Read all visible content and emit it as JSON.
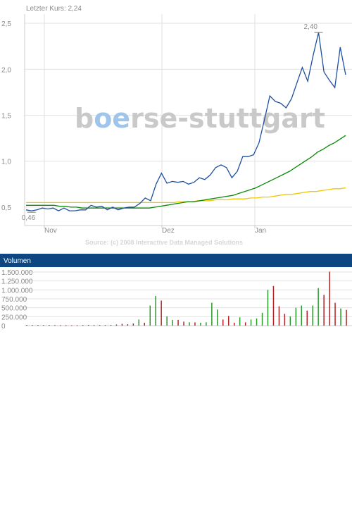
{
  "header": {
    "last_price": "Letzter Kurs: 2,24"
  },
  "watermark": {
    "prefix": "b",
    "oe": "oe",
    "suffix": "rse-stuttgart"
  },
  "source_text": "Source: (c) 2008 Interactive Data Managed Solutions",
  "volume_section": {
    "title": "Volumen"
  },
  "colors": {
    "price": "#1f4fa0",
    "ma_green": "#0a8a0a",
    "ma_yellow": "#f0c800",
    "vol_up": "#2a9a2a",
    "vol_down": "#b22222",
    "title_bar": "#0d4680",
    "grid": "#e2e2e2",
    "watermark_oe": "#9fc5ea"
  },
  "chart_data": [
    {
      "type": "line",
      "title": "",
      "xlabel": "",
      "ylabel": "",
      "x_tick_labels": [
        "Nov",
        "Dez",
        "Jan"
      ],
      "y_tick_labels": [
        "0,5",
        "1,0",
        "1,5",
        "2,0",
        "2,5"
      ],
      "ylim": [
        0.3,
        2.6
      ],
      "grid": true,
      "annotations": [
        {
          "text": "2,40",
          "index": 46,
          "value": 2.4
        },
        {
          "text": "0,46",
          "index": 6,
          "value": 0.46
        }
      ],
      "x": [
        0,
        1,
        2,
        3,
        4,
        5,
        6,
        7,
        8,
        9,
        10,
        11,
        12,
        13,
        14,
        15,
        16,
        17,
        18,
        19,
        20,
        21,
        22,
        23,
        24,
        25,
        26,
        27,
        28,
        29,
        30,
        31,
        32,
        33,
        34,
        35,
        36,
        37,
        38,
        39,
        40,
        41,
        42,
        43,
        44,
        45,
        46,
        47,
        48,
        49,
        50,
        51
      ],
      "series": [
        {
          "values": [
            0.47,
            0.46,
            0.47,
            0.49,
            0.48,
            0.49,
            0.46,
            0.49,
            0.46,
            0.46,
            0.47,
            0.47,
            0.52,
            0.5,
            0.51,
            0.47,
            0.5,
            0.47,
            0.49,
            0.5,
            0.5,
            0.54,
            0.6,
            0.57,
            0.75,
            0.87,
            0.76,
            0.78,
            0.77,
            0.78,
            0.75,
            0.77,
            0.82,
            0.8,
            0.85,
            0.93,
            0.96,
            0.93,
            0.82,
            0.89,
            1.05,
            1.05,
            1.07,
            1.2,
            1.45,
            1.71,
            1.65,
            1.63,
            1.58,
            1.68,
            1.85,
            2.02,
            1.87,
            2.15,
            2.4,
            1.97,
            1.88,
            1.8,
            2.24,
            1.94
          ]
        },
        {
          "values": [
            0.52,
            0.52,
            0.52,
            0.52,
            0.52,
            0.52,
            0.51,
            0.51,
            0.5,
            0.5,
            0.49,
            0.49,
            0.49,
            0.49,
            0.49,
            0.49,
            0.49,
            0.49,
            0.49,
            0.49,
            0.49,
            0.49,
            0.49,
            0.5,
            0.51,
            0.52,
            0.53,
            0.54,
            0.55,
            0.56,
            0.56,
            0.57,
            0.58,
            0.59,
            0.6,
            0.61,
            0.62,
            0.63,
            0.65,
            0.67,
            0.69,
            0.71,
            0.74,
            0.77,
            0.8,
            0.83,
            0.86,
            0.89,
            0.93,
            0.97,
            1.01,
            1.05,
            1.1,
            1.13,
            1.17,
            1.2,
            1.24,
            1.28
          ]
        },
        {
          "values": [
            0.55,
            0.55,
            0.55,
            0.55,
            0.55,
            0.55,
            0.55,
            0.55,
            0.55,
            0.55,
            0.55,
            0.55,
            0.55,
            0.55,
            0.55,
            0.55,
            0.55,
            0.55,
            0.55,
            0.55,
            0.55,
            0.55,
            0.55,
            0.55,
            0.55,
            0.55,
            0.56,
            0.56,
            0.56,
            0.57,
            0.57,
            0.57,
            0.58,
            0.58,
            0.58,
            0.59,
            0.59,
            0.59,
            0.6,
            0.6,
            0.61,
            0.61,
            0.62,
            0.63,
            0.64,
            0.64,
            0.65,
            0.66,
            0.67,
            0.67,
            0.68,
            0.69,
            0.7,
            0.7,
            0.71
          ]
        }
      ]
    },
    {
      "type": "bar",
      "title": "Volumen",
      "y_tick_labels": [
        "0",
        "250.000",
        "500.000",
        "750.000",
        "1.000.000",
        "1.250.000",
        "1.500.000"
      ],
      "ylim": [
        0,
        1500000
      ],
      "values": [
        20000,
        15000,
        18000,
        16000,
        15000,
        14000,
        12000,
        11000,
        10000,
        9000,
        15000,
        20000,
        14000,
        18000,
        16000,
        20000,
        30000,
        50000,
        40000,
        60000,
        170000,
        80000,
        560000,
        830000,
        700000,
        260000,
        160000,
        160000,
        110000,
        90000,
        90000,
        80000,
        90000,
        640000,
        450000,
        170000,
        270000,
        80000,
        230000,
        90000,
        170000,
        200000,
        360000,
        1000000,
        1110000,
        540000,
        330000,
        260000,
        500000,
        560000,
        420000,
        560000,
        1050000,
        860000,
        1510000,
        640000,
        480000,
        440000
      ],
      "directions": [
        "d",
        "d",
        "d",
        "d",
        "d",
        "d",
        "d",
        "d",
        "d",
        "d",
        "d",
        "d",
        "d",
        "d",
        "d",
        "d",
        "d",
        "d",
        "d",
        "d",
        "u",
        "d",
        "u",
        "u",
        "d",
        "u",
        "u",
        "d",
        "d",
        "u",
        "d",
        "u",
        "u",
        "u",
        "u",
        "d",
        "d",
        "d",
        "u",
        "d",
        "u",
        "u",
        "u",
        "u",
        "d",
        "d",
        "d",
        "u",
        "u",
        "u",
        "d",
        "u",
        "u",
        "d",
        "d",
        "d",
        "u",
        "d"
      ]
    }
  ]
}
